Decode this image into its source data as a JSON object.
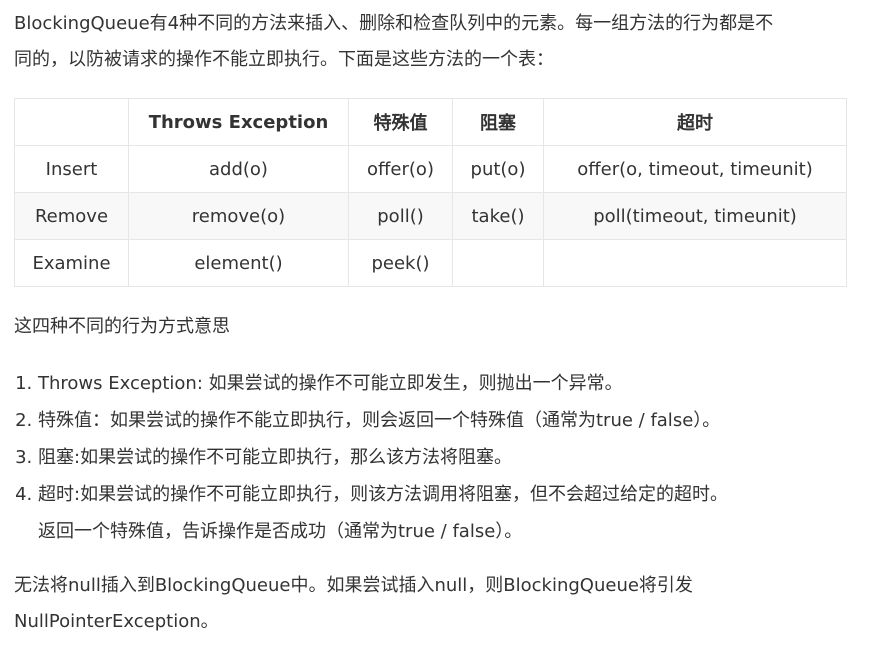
{
  "intro": {
    "line1": "BlockingQueue有4种不同的方法来插入、删除和检查队列中的元素。每一组方法的行为都是不",
    "line2": "同的，以防被请求的操作不能立即执行。下面是这些方法的一个表："
  },
  "table": {
    "headers": [
      "",
      "Throws Exception",
      "特殊值",
      "阻塞",
      "超时"
    ],
    "rows": [
      [
        "Insert",
        "add(o)",
        "offer(o)",
        "put(o)",
        "offer(o, timeout, timeunit)"
      ],
      [
        "Remove",
        "remove(o)",
        "poll()",
        "take()",
        "poll(timeout, timeunit)"
      ],
      [
        "Examine",
        "element()",
        "peek()",
        "",
        ""
      ]
    ]
  },
  "summary": "这四种不同的行为方式意思",
  "behaviors": [
    "Throws Exception: 如果尝试的操作不可能立即发生，则抛出一个异常。",
    "特殊值：如果尝试的操作不能立即执行，则会返回一个特殊值（通常为true / false）。",
    "阻塞:如果尝试的操作不可能立即执行，那么该方法将阻塞。",
    "超时:如果尝试的操作不可能立即执行，则该方法调用将阻塞，但不会超过给定的超时。"
  ],
  "behavior4_line2": "返回一个特殊值，告诉操作是否成功（通常为true / false）。",
  "outro": {
    "line1": "无法将null插入到BlockingQueue中。如果尝试插入null，则BlockingQueue将引发",
    "line2": "NullPointerException。"
  }
}
